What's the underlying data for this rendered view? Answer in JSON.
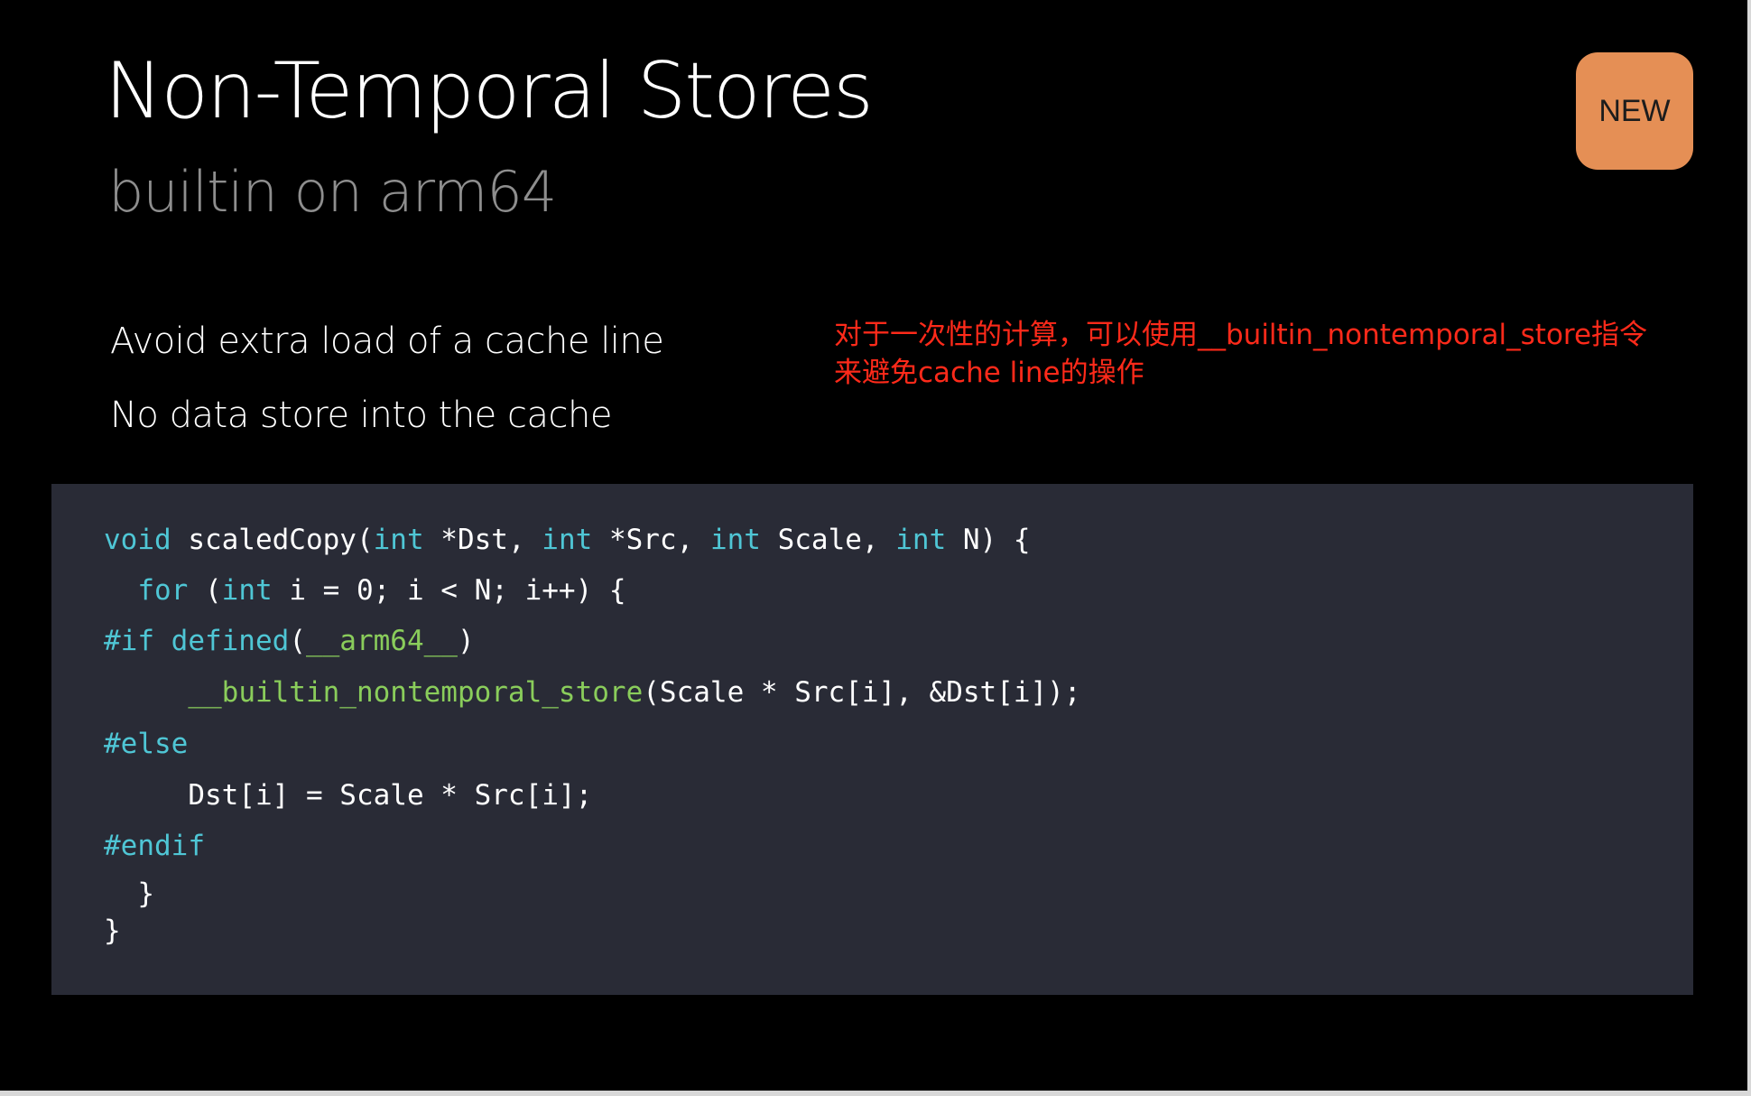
{
  "slide": {
    "title": "Non-Temporal Stores",
    "subtitle": "builtin on arm64",
    "badge": "NEW",
    "bullets": [
      "Avoid extra load of a cache line",
      "No data store into the cache"
    ],
    "annotation": {
      "line1": "对于一次性的计算，可以使用__builtin_nontemporal_store指令",
      "line2": "来避免cache line的操作"
    },
    "code": [
      [
        {
          "t": "void",
          "c": "kw"
        },
        {
          "t": " scaledCopy(",
          "c": ""
        },
        {
          "t": "int",
          "c": "kw"
        },
        {
          "t": " *Dst, ",
          "c": ""
        },
        {
          "t": "int",
          "c": "kw"
        },
        {
          "t": " *Src, ",
          "c": ""
        },
        {
          "t": "int",
          "c": "kw"
        },
        {
          "t": " Scale, ",
          "c": ""
        },
        {
          "t": "int",
          "c": "kw"
        },
        {
          "t": " N) {",
          "c": ""
        }
      ],
      [
        {
          "t": "  ",
          "c": ""
        },
        {
          "t": "for",
          "c": "kw"
        },
        {
          "t": " (",
          "c": ""
        },
        {
          "t": "int",
          "c": "kw"
        },
        {
          "t": " i = 0; i < N; i++) {",
          "c": ""
        }
      ],
      [
        {
          "t": "#if defined",
          "c": "pp"
        },
        {
          "t": "(",
          "c": ""
        },
        {
          "t": "__arm64__",
          "c": "fn"
        },
        {
          "t": ")",
          "c": ""
        }
      ],
      [
        {
          "t": "     ",
          "c": ""
        },
        {
          "t": "__builtin_nontemporal_store",
          "c": "fn"
        },
        {
          "t": "(Scale * Src[i], &Dst[i]);",
          "c": ""
        }
      ],
      [
        {
          "t": "#else",
          "c": "pp"
        }
      ],
      [
        {
          "t": "     Dst[i] = Scale * Src[i];",
          "c": ""
        }
      ],
      [
        {
          "t": "#endif",
          "c": "pp"
        }
      ],
      [
        {
          "t": "  }",
          "c": ""
        }
      ],
      [
        {
          "t": "}",
          "c": ""
        }
      ]
    ]
  },
  "colors": {
    "background": "#000000",
    "badge": "#e58f55",
    "annotation": "#ff2a1a",
    "code_background": "#292b36",
    "keyword": "#4fc6d5",
    "builtin": "#8acd5b"
  }
}
